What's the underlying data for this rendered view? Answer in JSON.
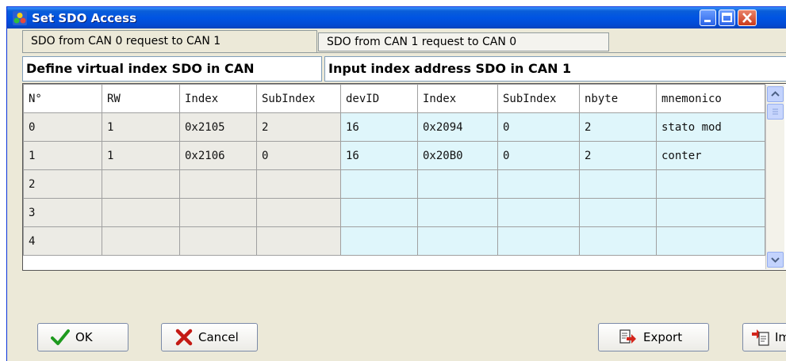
{
  "window": {
    "title": "Set SDO Access"
  },
  "tabs": [
    {
      "label": "SDO from CAN 0 request to CAN 1"
    },
    {
      "label": "SDO from CAN 1 request to CAN 0"
    }
  ],
  "sections": {
    "left": "Define virtual index SDO in CAN",
    "right": "Input index address SDO in CAN 1"
  },
  "table": {
    "columns": [
      "N°",
      "RW",
      "Index",
      "SubIndex",
      "devID",
      "Index",
      "SubIndex",
      "nbyte",
      "mnemonico"
    ],
    "rows": [
      [
        "0",
        "1",
        "0x2105",
        "2",
        "16",
        "0x2094",
        "0",
        "2",
        "stato mod"
      ],
      [
        "1",
        "1",
        "0x2106",
        "0",
        "16",
        "0x20B0",
        "0",
        "2",
        "conter"
      ],
      [
        "2",
        "",
        "",
        "",
        "",
        "",
        "",
        "",
        ""
      ],
      [
        "3",
        "",
        "",
        "",
        "",
        "",
        "",
        "",
        ""
      ],
      [
        "4",
        "",
        "",
        "",
        "",
        "",
        "",
        "",
        ""
      ]
    ]
  },
  "buttons": {
    "ok": "OK",
    "cancel": "Cancel",
    "export": "Export",
    "import": "Import"
  },
  "colors": {
    "title_bar": "#0054e3",
    "window_bg": "#ece9d8",
    "left_cells": "#ecebe5",
    "right_cells": "#dff6fb"
  }
}
